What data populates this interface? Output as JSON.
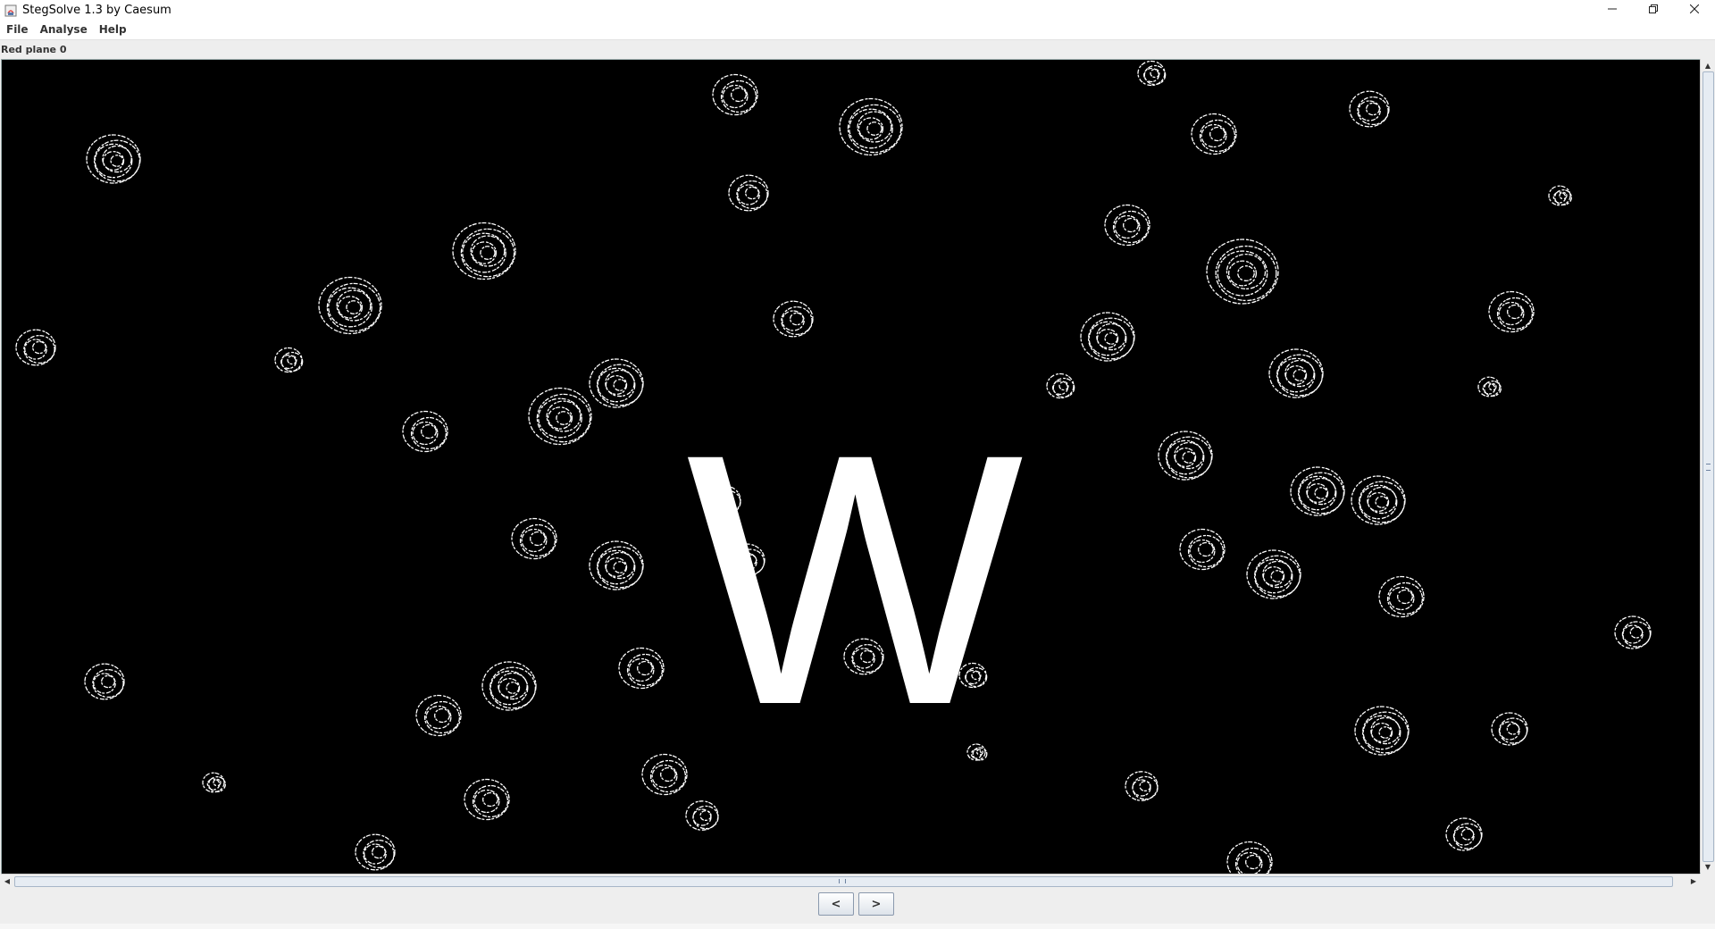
{
  "window": {
    "title": "StegSolve 1.3 by Caesum",
    "controls": {
      "minimize": "minimize-icon",
      "maximize": "restore-icon",
      "close": "close-icon"
    }
  },
  "menu": {
    "items": [
      {
        "label": "File"
      },
      {
        "label": "Analyse"
      },
      {
        "label": "Help"
      }
    ]
  },
  "view": {
    "plane_label": "Red plane 0",
    "image_letter": "W",
    "background_color": "#000000",
    "foreground_color": "#ffffff"
  },
  "navigation": {
    "prev_label": "<",
    "next_label": ">"
  }
}
